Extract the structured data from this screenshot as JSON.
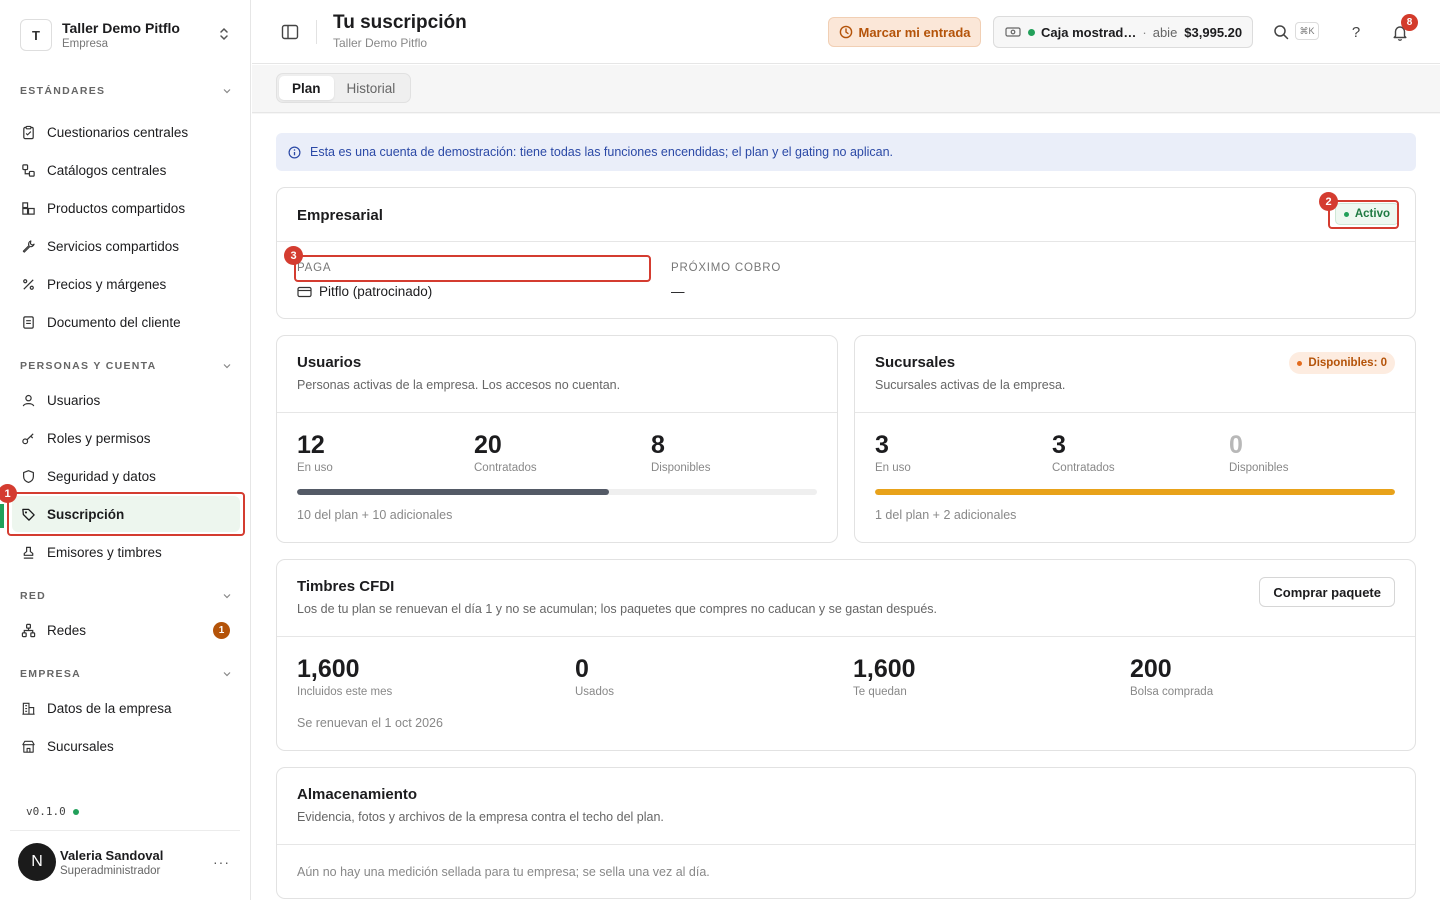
{
  "org": {
    "initial": "T",
    "name": "Taller Demo Pitflo",
    "type": "Empresa"
  },
  "sidebar": {
    "sections": [
      {
        "title": "ESTÁNDARES"
      },
      {
        "title": "PERSONAS Y CUENTA"
      },
      {
        "title": "RED"
      },
      {
        "title": "EMPRESA"
      }
    ],
    "items": [
      {
        "label": "Cuestionarios centrales",
        "icon": "clipboard-icon"
      },
      {
        "label": "Catálogos centrales",
        "icon": "workflow-icon"
      },
      {
        "label": "Productos compartidos",
        "icon": "boxes-icon"
      },
      {
        "label": "Servicios compartidos",
        "icon": "wrench-icon"
      },
      {
        "label": "Precios y márgenes",
        "icon": "percent-icon"
      },
      {
        "label": "Documento del cliente",
        "icon": "document-icon"
      },
      {
        "label": "Usuarios",
        "icon": "user-icon"
      },
      {
        "label": "Roles y permisos",
        "icon": "key-icon"
      },
      {
        "label": "Seguridad y datos",
        "icon": "shield-icon"
      },
      {
        "label": "Suscripción",
        "icon": "tag-icon"
      },
      {
        "label": "Emisores y timbres",
        "icon": "stamp-icon"
      },
      {
        "label": "Redes",
        "icon": "network-icon",
        "count": "1"
      },
      {
        "label": "Datos de la empresa",
        "icon": "building-icon"
      },
      {
        "label": "Sucursales",
        "icon": "store-icon"
      }
    ],
    "version": "v0.1.0"
  },
  "user": {
    "initial": "N",
    "name": "Valeria Sandoval",
    "role": "Superadministrador",
    "more": "···"
  },
  "header": {
    "title": "Tu suscripción",
    "subtitle": "Taller Demo Pitflo",
    "clock_button": "Marcar mi entrada",
    "cash": {
      "name": "Caja mostrad…",
      "separator": "·",
      "state": "abie",
      "amount": "$3,995.20"
    },
    "shortcut": "⌘K",
    "help": "?",
    "notifications": "8"
  },
  "tabs": [
    {
      "label": "Plan"
    },
    {
      "label": "Historial"
    }
  ],
  "banner": "Esta es una cuenta de demostración: tiene todas las funciones encendidas; el plan y el gating no aplican.",
  "plan": {
    "name": "Empresarial",
    "status": "Activo",
    "pays_label": "PAGA",
    "pays_value": "Pitflo (patrocinado)",
    "next_label": "PRÓXIMO COBRO",
    "next_value": "—"
  },
  "users_card": {
    "title": "Usuarios",
    "desc": "Personas activas de la empresa. Los accesos no cuentan.",
    "stats": [
      {
        "value": "12",
        "label": "En uso"
      },
      {
        "value": "20",
        "label": "Contratados"
      },
      {
        "value": "8",
        "label": "Disponibles"
      }
    ],
    "usage_fraction": 0.6,
    "bar_color": "#545a66",
    "footer": "10 del plan + 10 adicionales"
  },
  "branches_card": {
    "title": "Sucursales",
    "desc": "Sucursales activas de la empresa.",
    "badge": "Disponibles: 0",
    "stats": [
      {
        "value": "3",
        "label": "En uso"
      },
      {
        "value": "3",
        "label": "Contratados"
      },
      {
        "value": "0",
        "label": "Disponibles"
      }
    ],
    "usage_fraction": 1.0,
    "bar_color": "#e8a21a",
    "footer": "1 del plan + 2 adicionales"
  },
  "stamps_card": {
    "title": "Timbres CFDI",
    "desc": "Los de tu plan se renuevan el día 1 y no se acumulan; los paquetes que compres no caducan y se gastan después.",
    "buy_button": "Comprar paquete",
    "stats": [
      {
        "value": "1,600",
        "label": "Incluidos este mes"
      },
      {
        "value": "0",
        "label": "Usados"
      },
      {
        "value": "1,600",
        "label": "Te quedan"
      },
      {
        "value": "200",
        "label": "Bolsa comprada"
      }
    ],
    "footer": "Se renuevan el 1 oct 2026"
  },
  "storage_card": {
    "title": "Almacenamiento",
    "desc": "Evidencia, fotos y archivos de la empresa contra el techo del plan.",
    "note": "Aún no hay una medición sellada para tu empresa; se sella una vez al día."
  },
  "annotations": [
    {
      "num": "1"
    },
    {
      "num": "2"
    },
    {
      "num": "3"
    }
  ],
  "colors": {
    "accent_green": "#22a05a",
    "warning": "#b45309",
    "danger": "#d43c30",
    "info": "#2b49a6"
  }
}
